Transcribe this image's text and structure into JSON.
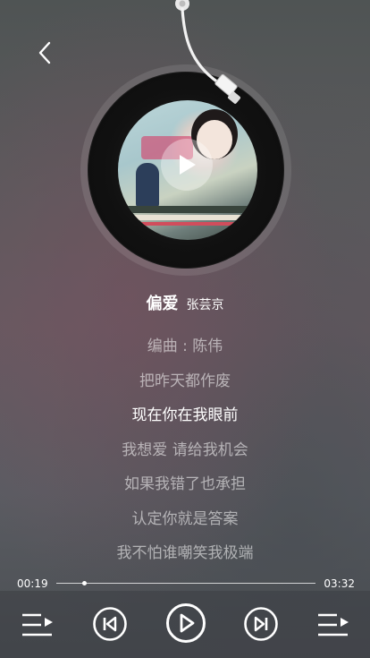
{
  "header": {
    "back_icon": "chevron-left-icon"
  },
  "player": {
    "song_title": "偏爱",
    "artist": "张芸京",
    "current_time": "00:19",
    "total_time": "03:32",
    "progress": 0.1
  },
  "lyrics": [
    {
      "text": "编曲 : 陈伟",
      "active": false
    },
    {
      "text": "把昨天都作废",
      "active": false
    },
    {
      "text": "现在你在我眼前",
      "active": true
    },
    {
      "text": "我想爱 请给我机会",
      "active": false
    },
    {
      "text": "如果我错了也承担",
      "active": false
    },
    {
      "text": "认定你就是答案",
      "active": false
    },
    {
      "text": "我不怕谁嘲笑我极端",
      "active": false
    }
  ],
  "controls": {
    "left": "playlist-icon",
    "prev": "previous-icon",
    "play": "play-icon",
    "next": "next-icon",
    "right": "queue-icon"
  },
  "colors": {
    "accent": "#ffffff",
    "bar_bg": "#3c3e44"
  }
}
